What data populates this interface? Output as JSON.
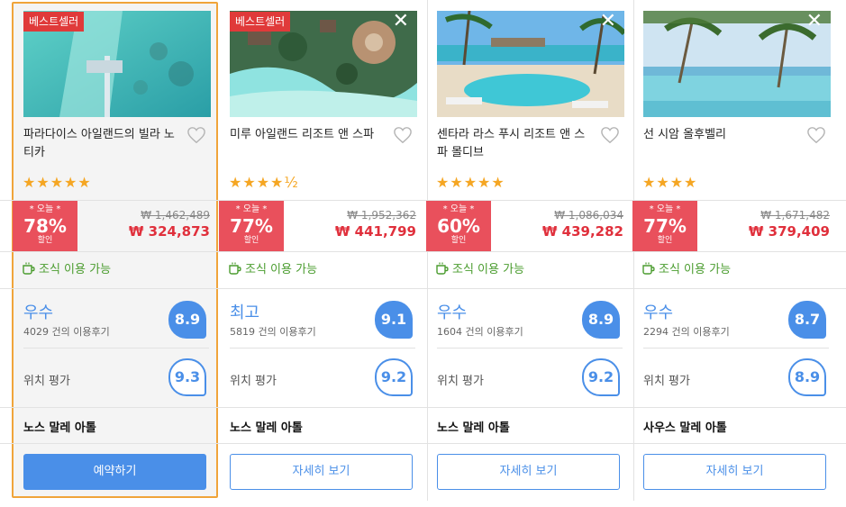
{
  "hotels": [
    {
      "badge": "베스트셀러",
      "name": "파라다이스 아일랜드의 빌라 노티카",
      "stars": "★★★★★",
      "deal_today": "* 오늘 *",
      "discount": "78%",
      "discount_label": "할인",
      "original_price": "₩ 1,462,489",
      "price": "₩ 324,873",
      "breakfast": "조식 이용 가능",
      "rating_word": "우수",
      "reviews": "4029 건의 이용후기",
      "score": "8.9",
      "location_label": "위치 평가",
      "location_score": "9.3",
      "area": "노스 말레 아톨",
      "button": "예약하기",
      "selected": true
    },
    {
      "badge": "베스트셀러",
      "close": "✕",
      "name": "미루 아일랜드 리조트 앤 스파",
      "stars": "★★★★½",
      "deal_today": "* 오늘 *",
      "discount": "77%",
      "discount_label": "할인",
      "original_price": "₩ 1,952,362",
      "price": "₩ 441,799",
      "breakfast": "조식 이용 가능",
      "rating_word": "최고",
      "reviews": "5819 건의 이용후기",
      "score": "9.1",
      "location_label": "위치 평가",
      "location_score": "9.2",
      "area": "노스 말레 아톨",
      "button": "자세히 보기"
    },
    {
      "close": "✕",
      "name": "센타라 라스 푸시 리조트 앤 스파 몰디브",
      "stars": "★★★★★",
      "deal_today": "* 오늘 *",
      "discount": "60%",
      "discount_label": "할인",
      "original_price": "₩ 1,086,034",
      "price": "₩ 439,282",
      "breakfast": "조식 이용 가능",
      "rating_word": "우수",
      "reviews": "1604 건의 이용후기",
      "score": "8.9",
      "location_label": "위치 평가",
      "location_score": "9.2",
      "area": "노스 말레 아톨",
      "button": "자세히 보기"
    },
    {
      "close": "✕",
      "name": "선 시암 올후벨리",
      "stars": "★★★★",
      "deal_today": "* 오늘 *",
      "discount": "77%",
      "discount_label": "할인",
      "original_price": "₩ 1,671,482",
      "price": "₩ 379,409",
      "breakfast": "조식 이용 가능",
      "rating_word": "우수",
      "reviews": "2294 건의 이용후기",
      "score": "8.7",
      "location_label": "위치 평가",
      "location_score": "8.9",
      "area": "사우스 말레 아톨",
      "button": "자세히 보기"
    }
  ],
  "colors": {
    "accent": "#4a8fe8",
    "deal": "#e9505c",
    "price": "#e0303c",
    "badge": "#e03a3a",
    "selected_border": "#f0a43a",
    "breakfast": "#4a9c2e",
    "stars": "#f5a623"
  },
  "icons": {
    "heart": "heart-icon",
    "close": "close-icon",
    "breakfast": "coffee-cup-icon"
  }
}
